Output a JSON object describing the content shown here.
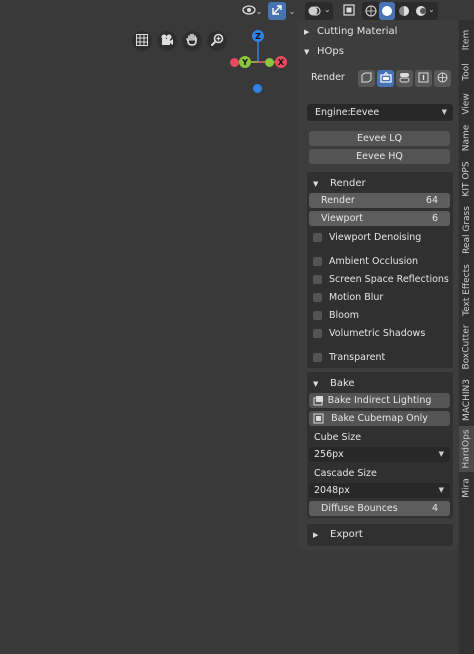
{
  "viewport_header": {
    "visibility_icon": "eye-icon",
    "gizmo_icon": "gizmo-icon",
    "overlays_icon": "overlays-icon",
    "xray_icon": "xray-icon",
    "shading_icons": [
      "wireframe-icon",
      "solid-icon",
      "material-icon",
      "rendered-icon"
    ]
  },
  "navigation": {
    "buttons": [
      "grid-icon",
      "camera-icon",
      "hand-icon",
      "zoom-icon"
    ],
    "axes": {
      "z": "Z",
      "y": "Y",
      "x": "X"
    }
  },
  "panel": {
    "cutting_material": "Cutting Material",
    "hops": "HOps",
    "render_label": "Render",
    "engine_label": "Engine:",
    "engine_value": "Eevee",
    "eevee_lq": "Eevee LQ",
    "eevee_hq": "Eevee HQ",
    "render_section": {
      "title": "Render",
      "render_samples_label": "Render",
      "render_samples_value": "64",
      "viewport_samples_label": "Viewport",
      "viewport_samples_value": "6",
      "viewport_denoising": "Viewport Denoising",
      "ambient_occlusion": "Ambient Occlusion",
      "ssr": "Screen Space Reflections",
      "motion_blur": "Motion Blur",
      "bloom": "Bloom",
      "volumetric_shadows": "Volumetric Shadows",
      "transparent": "Transparent"
    },
    "bake_section": {
      "title": "Bake",
      "bake_indirect": "Bake Indirect Lighting",
      "bake_cubemap": "Bake Cubemap Only",
      "cube_size_label": "Cube Size",
      "cube_size_value": "256px",
      "cascade_size_label": "Cascade Size",
      "cascade_size_value": "2048px",
      "diffuse_bounces_label": "Diffuse Bounces",
      "diffuse_bounces_value": "4"
    },
    "export": "Export"
  },
  "tabs": [
    "Item",
    "Tool",
    "View",
    "Name",
    "KIT OPS",
    "Real Grass",
    "Text Effects",
    "BoxCutter",
    "MACHIN3",
    "HardOps",
    "Mira"
  ],
  "colors": {
    "accent": "#4772b3",
    "axis_x": "#e84a5f",
    "axis_y": "#8cc63f",
    "axis_z": "#2f83e6"
  }
}
